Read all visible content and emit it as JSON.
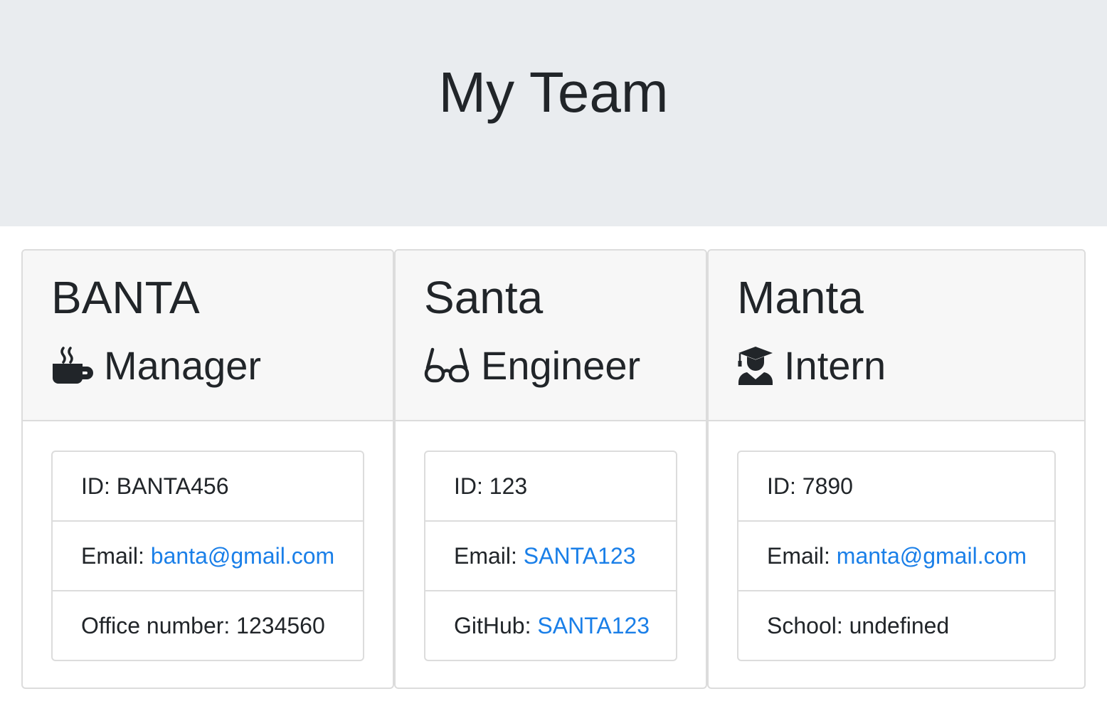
{
  "header": {
    "title": "My Team"
  },
  "cards": [
    {
      "name": "BANTA",
      "role": "Manager",
      "role_icon": "coffee-mug-icon",
      "id_label": "ID: ",
      "id_value": "BANTA456",
      "email_label": "Email: ",
      "email_value": "banta@gmail.com",
      "extra_label": "Office number: ",
      "extra_value": "1234560"
    },
    {
      "name": "Santa",
      "role": "Engineer",
      "role_icon": "glasses-icon",
      "id_label": "ID: ",
      "id_value": "123",
      "email_label": "Email: ",
      "email_value": "SANTA123",
      "extra_label": "GitHub: ",
      "extra_value": "SANTA123"
    },
    {
      "name": "Manta",
      "role": "Intern",
      "role_icon": "graduate-icon",
      "id_label": "ID: ",
      "id_value": "7890",
      "email_label": "Email: ",
      "email_value": "manta@gmail.com",
      "extra_label": "School: ",
      "extra_value": "undefined"
    }
  ],
  "colors": {
    "header_bg": "#e9ecef",
    "card_header_bg": "#f7f7f7",
    "link": "#1a7fe8",
    "text": "#212529"
  }
}
